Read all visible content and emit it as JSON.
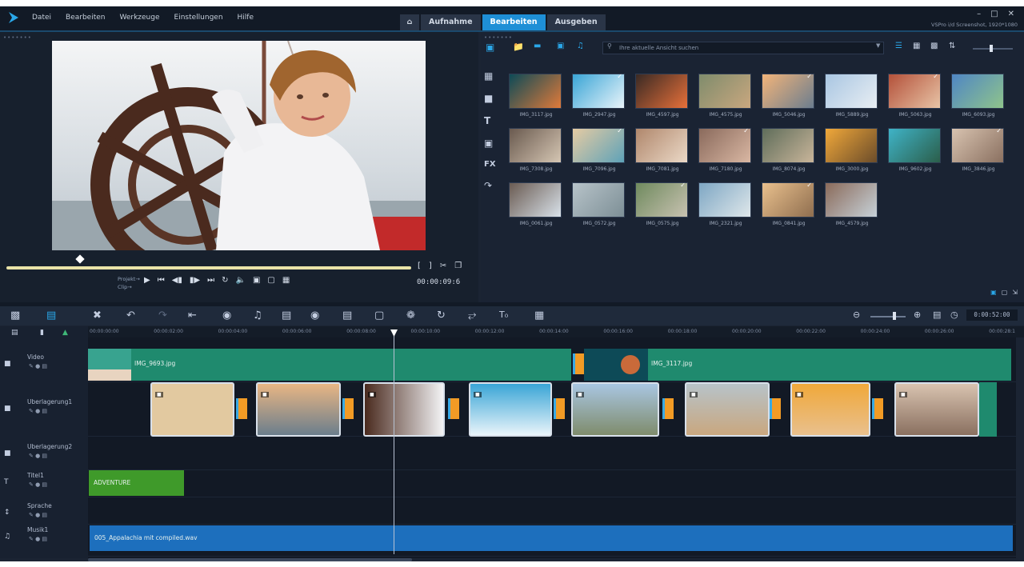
{
  "menu": [
    "Datei",
    "Bearbeiten",
    "Werkzeuge",
    "Einstellungen",
    "Hilfe"
  ],
  "tabs": {
    "home_icon": "home-icon",
    "capture": "Aufnahme",
    "edit": "Bearbeiten",
    "output": "Ausgeben",
    "active": "edit"
  },
  "window": {
    "title": "VSPro i/d Screenshot, 1920*1080",
    "minimize": "–",
    "maximize": "□",
    "close": "✕"
  },
  "player": {
    "mode_project": "Projekt→",
    "mode_clip": "Clip→",
    "timecode": "00:00:09:6",
    "scrub_progress": 0.19
  },
  "library": {
    "search_placeholder": "Ihre aktuelle Ansicht suchen",
    "thumbnails": [
      {
        "label": "IMG_3117.jpg",
        "colors": [
          "#0d4a57",
          "#e07a3a"
        ],
        "checked": false
      },
      {
        "label": "IMG_2947.jpg",
        "colors": [
          "#3aa5d6",
          "#e9f4fa"
        ],
        "checked": true
      },
      {
        "label": "IMG_4597.jpg",
        "colors": [
          "#3a2a24",
          "#e7703a"
        ],
        "checked": false
      },
      {
        "label": "IMG_4575.jpg",
        "colors": [
          "#7f8c6c",
          "#c9a77f"
        ],
        "checked": false
      },
      {
        "label": "IMG_5046.jpg",
        "colors": [
          "#f2b47a",
          "#6b7d8e"
        ],
        "checked": true
      },
      {
        "label": "IMG_5889.jpg",
        "colors": [
          "#a9c6e2",
          "#e8eef3"
        ],
        "checked": false
      },
      {
        "label": "IMG_5063.jpg",
        "colors": [
          "#b4513a",
          "#e8c4a6"
        ],
        "checked": true
      },
      {
        "label": "IMG_6093.jpg",
        "colors": [
          "#4f86c4",
          "#8fc48b"
        ],
        "checked": false
      },
      {
        "label": "IMG_7308.jpg",
        "colors": [
          "#6a5a4f",
          "#d5c6b3"
        ],
        "checked": false
      },
      {
        "label": "IMG_7096.jpg",
        "colors": [
          "#e5cba3",
          "#5ea2b8"
        ],
        "checked": true
      },
      {
        "label": "IMG_7081.jpg",
        "colors": [
          "#b0876c",
          "#ebd9c7"
        ],
        "checked": false
      },
      {
        "label": "IMG_7180.jpg",
        "colors": [
          "#8a6a5c",
          "#d9b7a3"
        ],
        "checked": true
      },
      {
        "label": "IMG_8074.jpg",
        "colors": [
          "#5f6d5a",
          "#c9b59a"
        ],
        "checked": false
      },
      {
        "label": "IMG_3000.jpg",
        "colors": [
          "#f0a83a",
          "#6b4c2a"
        ],
        "checked": false
      },
      {
        "label": "IMG_9602.jpg",
        "colors": [
          "#3fb3c7",
          "#2b5e4a"
        ],
        "checked": false
      },
      {
        "label": "IMG_3846.jpg",
        "colors": [
          "#d8c3b0",
          "#8a7060"
        ],
        "checked": true
      },
      {
        "label": "IMG_0061.jpg",
        "colors": [
          "#6a5b52",
          "#d9e2ea"
        ],
        "checked": false
      },
      {
        "label": "IMG_0572.jpg",
        "colors": [
          "#b7c3c9",
          "#7d8f96"
        ],
        "checked": false
      },
      {
        "label": "IMG_0575.jpg",
        "colors": [
          "#6f8a5e",
          "#c8c2b1"
        ],
        "checked": true
      },
      {
        "label": "IMG_2321.jpg",
        "colors": [
          "#7ea7c4",
          "#dfe7ea"
        ],
        "checked": false
      },
      {
        "label": "IMG_0841.jpg",
        "colors": [
          "#e9c08d",
          "#8f6e4f"
        ],
        "checked": true
      },
      {
        "label": "IMG_4579.jpg",
        "colors": [
          "#8a6a5a",
          "#c7d2d9"
        ],
        "checked": false
      }
    ]
  },
  "timeline": {
    "duration": "0:00:52:00",
    "ruler": [
      "00:00:00:00",
      "00:00:02:00",
      "00:00:04:00",
      "00:00:06:00",
      "00:00:08:00",
      "00:00:10:00",
      "00:00:12:00",
      "00:00:14:00",
      "00:00:16:00",
      "00:00:18:00",
      "00:00:20:00",
      "00:00:22:00",
      "00:00:24:00",
      "00:00:26:00",
      "00:00:28:1"
    ],
    "tracks": [
      {
        "label": "Video",
        "icon": "video-track-icon"
      },
      {
        "label": "Uberlagerung1",
        "icon": "overlay-track-icon"
      },
      {
        "label": "Uberlagerung2",
        "icon": "overlay-track-icon"
      },
      {
        "label": "Titel1",
        "icon": "title-track-icon"
      },
      {
        "label": "Sprache",
        "icon": "voice-track-icon"
      },
      {
        "label": "Musik1",
        "icon": "music-track-icon"
      }
    ],
    "video_clips": [
      {
        "name": "IMG_9693.jpg"
      },
      {
        "name": "IMG_3117.jpg"
      }
    ],
    "title_clip": "ADVENTURE",
    "music_clip": "005_Appalachia mit compiled.wav"
  }
}
